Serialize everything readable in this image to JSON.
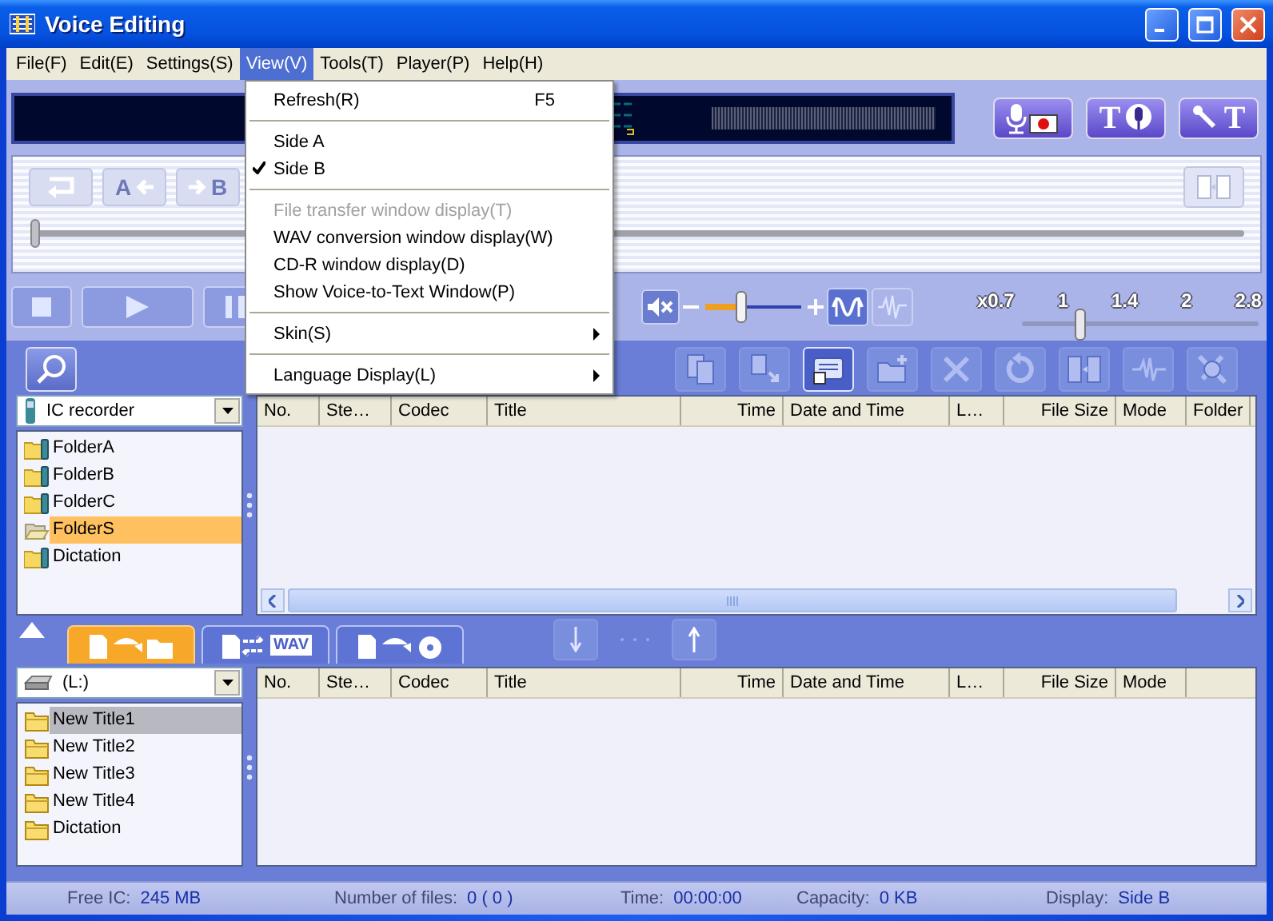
{
  "window": {
    "title": "Voice Editing"
  },
  "menu_bar": [
    {
      "label": "File(F)",
      "selected": false
    },
    {
      "label": "Edit(E)",
      "selected": false
    },
    {
      "label": "Settings(S)",
      "selected": false
    },
    {
      "label": "View(V)",
      "selected": true
    },
    {
      "label": "Tools(T)",
      "selected": false
    },
    {
      "label": "Player(P)",
      "selected": false
    },
    {
      "label": "Help(H)",
      "selected": false
    }
  ],
  "view_menu": [
    {
      "kind": "item",
      "label": "Refresh(R)",
      "shortcut": "F5",
      "checked": false,
      "disabled": false,
      "submenu": false
    },
    {
      "kind": "separator"
    },
    {
      "kind": "item",
      "label": "Side A",
      "checked": false,
      "disabled": false,
      "submenu": false
    },
    {
      "kind": "item",
      "label": "Side B",
      "checked": true,
      "disabled": false,
      "submenu": false
    },
    {
      "kind": "separator"
    },
    {
      "kind": "item",
      "label": "File transfer window display(T)",
      "checked": false,
      "disabled": true,
      "submenu": false
    },
    {
      "kind": "item",
      "label": "WAV conversion window display(W)",
      "checked": false,
      "disabled": false,
      "submenu": false
    },
    {
      "kind": "item",
      "label": "CD-R window display(D)",
      "checked": false,
      "disabled": false,
      "submenu": false
    },
    {
      "kind": "item",
      "label": "Show Voice-to-Text Window(P)",
      "checked": false,
      "disabled": false,
      "submenu": false
    },
    {
      "kind": "separator"
    },
    {
      "kind": "item",
      "label": "Skin(S)",
      "checked": false,
      "disabled": false,
      "submenu": true
    },
    {
      "kind": "separator"
    },
    {
      "kind": "item",
      "label": "Language Display(L)",
      "checked": false,
      "disabled": false,
      "submenu": true
    }
  ],
  "voice_buttons": [
    {
      "kind": "record"
    },
    {
      "kind": "text_to_voice",
      "label": "T"
    },
    {
      "kind": "voice_to_text",
      "label": "T"
    }
  ],
  "repeat_buttons": [
    {
      "kind": "loop",
      "disabled": true
    },
    {
      "kind": "a",
      "label": "A",
      "disabled": true
    },
    {
      "kind": "b",
      "label": "B",
      "disabled": true
    }
  ],
  "position_slider": {
    "level": 0
  },
  "volume": {
    "level": 0.37
  },
  "speed": {
    "labels": [
      "x0.7",
      "1",
      "1.4",
      "2",
      "2.8"
    ],
    "level": 0.24
  },
  "toolbar": [
    {
      "disabled": true
    },
    {
      "disabled": true
    },
    {
      "disabled": false
    },
    {
      "disabled": true
    },
    {
      "disabled": true
    },
    {
      "disabled": true
    },
    {
      "disabled": true
    },
    {
      "disabled": true
    },
    {
      "disabled": true
    }
  ],
  "panes": [
    {
      "focused": true,
      "source": {
        "kind": "recorder",
        "label": "IC recorder"
      },
      "tree": [
        {
          "label": "FolderA",
          "kind": "recorder_folder",
          "selected": false
        },
        {
          "label": "FolderB",
          "kind": "recorder_folder",
          "selected": false
        },
        {
          "label": "FolderC",
          "kind": "recorder_folder",
          "selected": false
        },
        {
          "label": "FolderS",
          "kind": "open_folder",
          "selected": true
        },
        {
          "label": "Dictation",
          "kind": "recorder_folder",
          "selected": false
        }
      ],
      "columns": [
        {
          "label": "No."
        },
        {
          "label": "Ste…"
        },
        {
          "label": "Codec"
        },
        {
          "label": "Title"
        },
        {
          "label": "Time"
        },
        {
          "label": "Date and Time"
        },
        {
          "label": "L…"
        },
        {
          "label": "File Size"
        },
        {
          "label": "Mode"
        },
        {
          "label": "Folder"
        }
      ],
      "scrollbar": true
    },
    {
      "focused": false,
      "source": {
        "kind": "drive",
        "label": "(L:)"
      },
      "tree": [
        {
          "label": "New Title1",
          "kind": "folder",
          "selected": true
        },
        {
          "label": "New Title2",
          "kind": "folder",
          "selected": false
        },
        {
          "label": "New Title3",
          "kind": "folder",
          "selected": false
        },
        {
          "label": "New Title4",
          "kind": "folder",
          "selected": false
        },
        {
          "label": "Dictation",
          "kind": "folder",
          "selected": false
        }
      ],
      "columns": [
        {
          "label": "No."
        },
        {
          "label": "Ste…"
        },
        {
          "label": "Codec"
        },
        {
          "label": "Title"
        },
        {
          "label": "Time"
        },
        {
          "label": "Date and Time"
        },
        {
          "label": "L…"
        },
        {
          "label": "File Size"
        },
        {
          "label": "Mode"
        }
      ],
      "scrollbar": false
    }
  ],
  "transfer_tabs": [
    {
      "kind": "to_folder",
      "selected": true
    },
    {
      "kind": "wav",
      "label": "WAV",
      "selected": false
    },
    {
      "kind": "to_disc",
      "selected": false
    }
  ],
  "status_bar": [
    {
      "label": "Free IC:",
      "value": "245 MB"
    },
    {
      "label": "Number of files:",
      "value": "0 ( 0 )"
    },
    {
      "label": "Time:",
      "value": "00:00:00"
    },
    {
      "label": "Capacity:",
      "value": "0 KB"
    },
    {
      "label": "Display:",
      "value": "Side B"
    }
  ]
}
